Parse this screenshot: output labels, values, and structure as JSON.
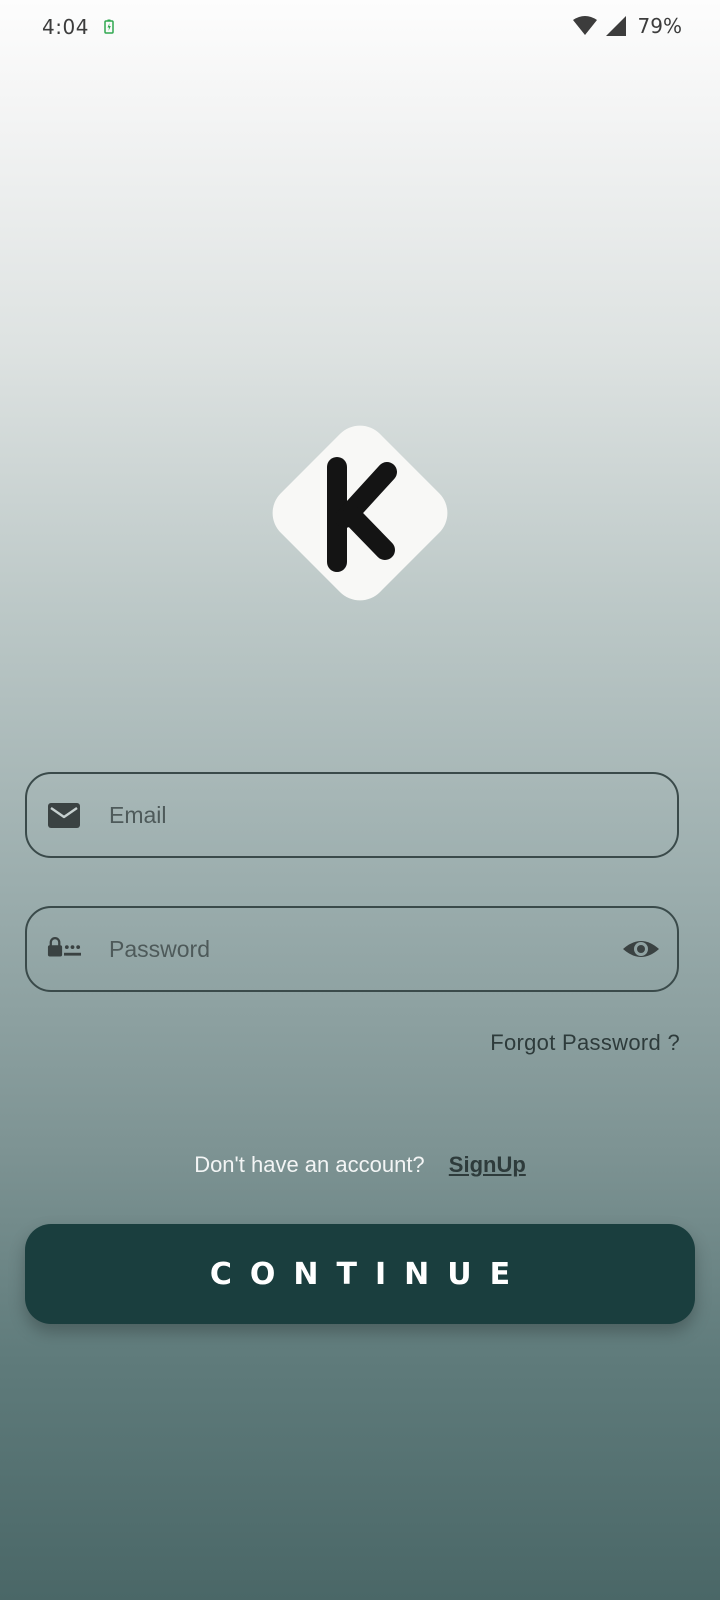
{
  "status_bar": {
    "time": "4:04",
    "battery": "79%",
    "icons": [
      "battery-charging-icon",
      "wifi-icon",
      "signal-icon"
    ]
  },
  "logo": {
    "letter": "K",
    "icon": "k-logo-icon"
  },
  "form": {
    "email": {
      "placeholder": "Email",
      "value": "",
      "icon": "mail-icon"
    },
    "password": {
      "placeholder": "Password",
      "value": "",
      "icon": "password-icon",
      "toggle_icon": "eye-icon"
    },
    "forgot_password": "Forgot Password ?"
  },
  "signup": {
    "prompt": "Don't have an account?",
    "link": "SignUp"
  },
  "actions": {
    "continue_label": "CONTINUE"
  },
  "colors": {
    "button": "#1a3e3e",
    "field_border": "#3a4a4a",
    "logo_fill": "#f8f8f6",
    "logo_letter": "#141414"
  }
}
